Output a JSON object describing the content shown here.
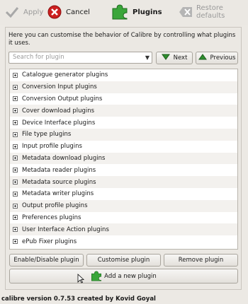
{
  "toolbar": {
    "apply": "Apply",
    "cancel": "Cancel",
    "plugins": "Plugins",
    "restore": "Restore defaults"
  },
  "description": "Here you can customise the behavior of Calibre by controlling what plugins it uses.",
  "search": {
    "placeholder": "Search for plugin"
  },
  "nav": {
    "next": "Next",
    "previous": "Previous"
  },
  "plugin_categories": [
    "Catalogue generator plugins",
    "Conversion Input plugins",
    "Conversion Output plugins",
    "Cover download plugins",
    "Device Interface plugins",
    "File type plugins",
    "Input profile plugins",
    "Metadata download plugins",
    "Metadata reader plugins",
    "Metadata source plugins",
    "Metadata writer plugins",
    "Output profile plugins",
    "Preferences plugins",
    "User Interface Action plugins",
    "ePub Fixer plugins"
  ],
  "actions": {
    "enable": "Enable/Disable plugin",
    "customise": "Customise plugin",
    "remove": "Remove plugin",
    "add": "Add a new plugin"
  },
  "status": "calibre version 0.7.53 created by Kovid Goyal",
  "colors": {
    "accent_green": "#2f8f2f",
    "cancel_red": "#cc1f1f"
  }
}
